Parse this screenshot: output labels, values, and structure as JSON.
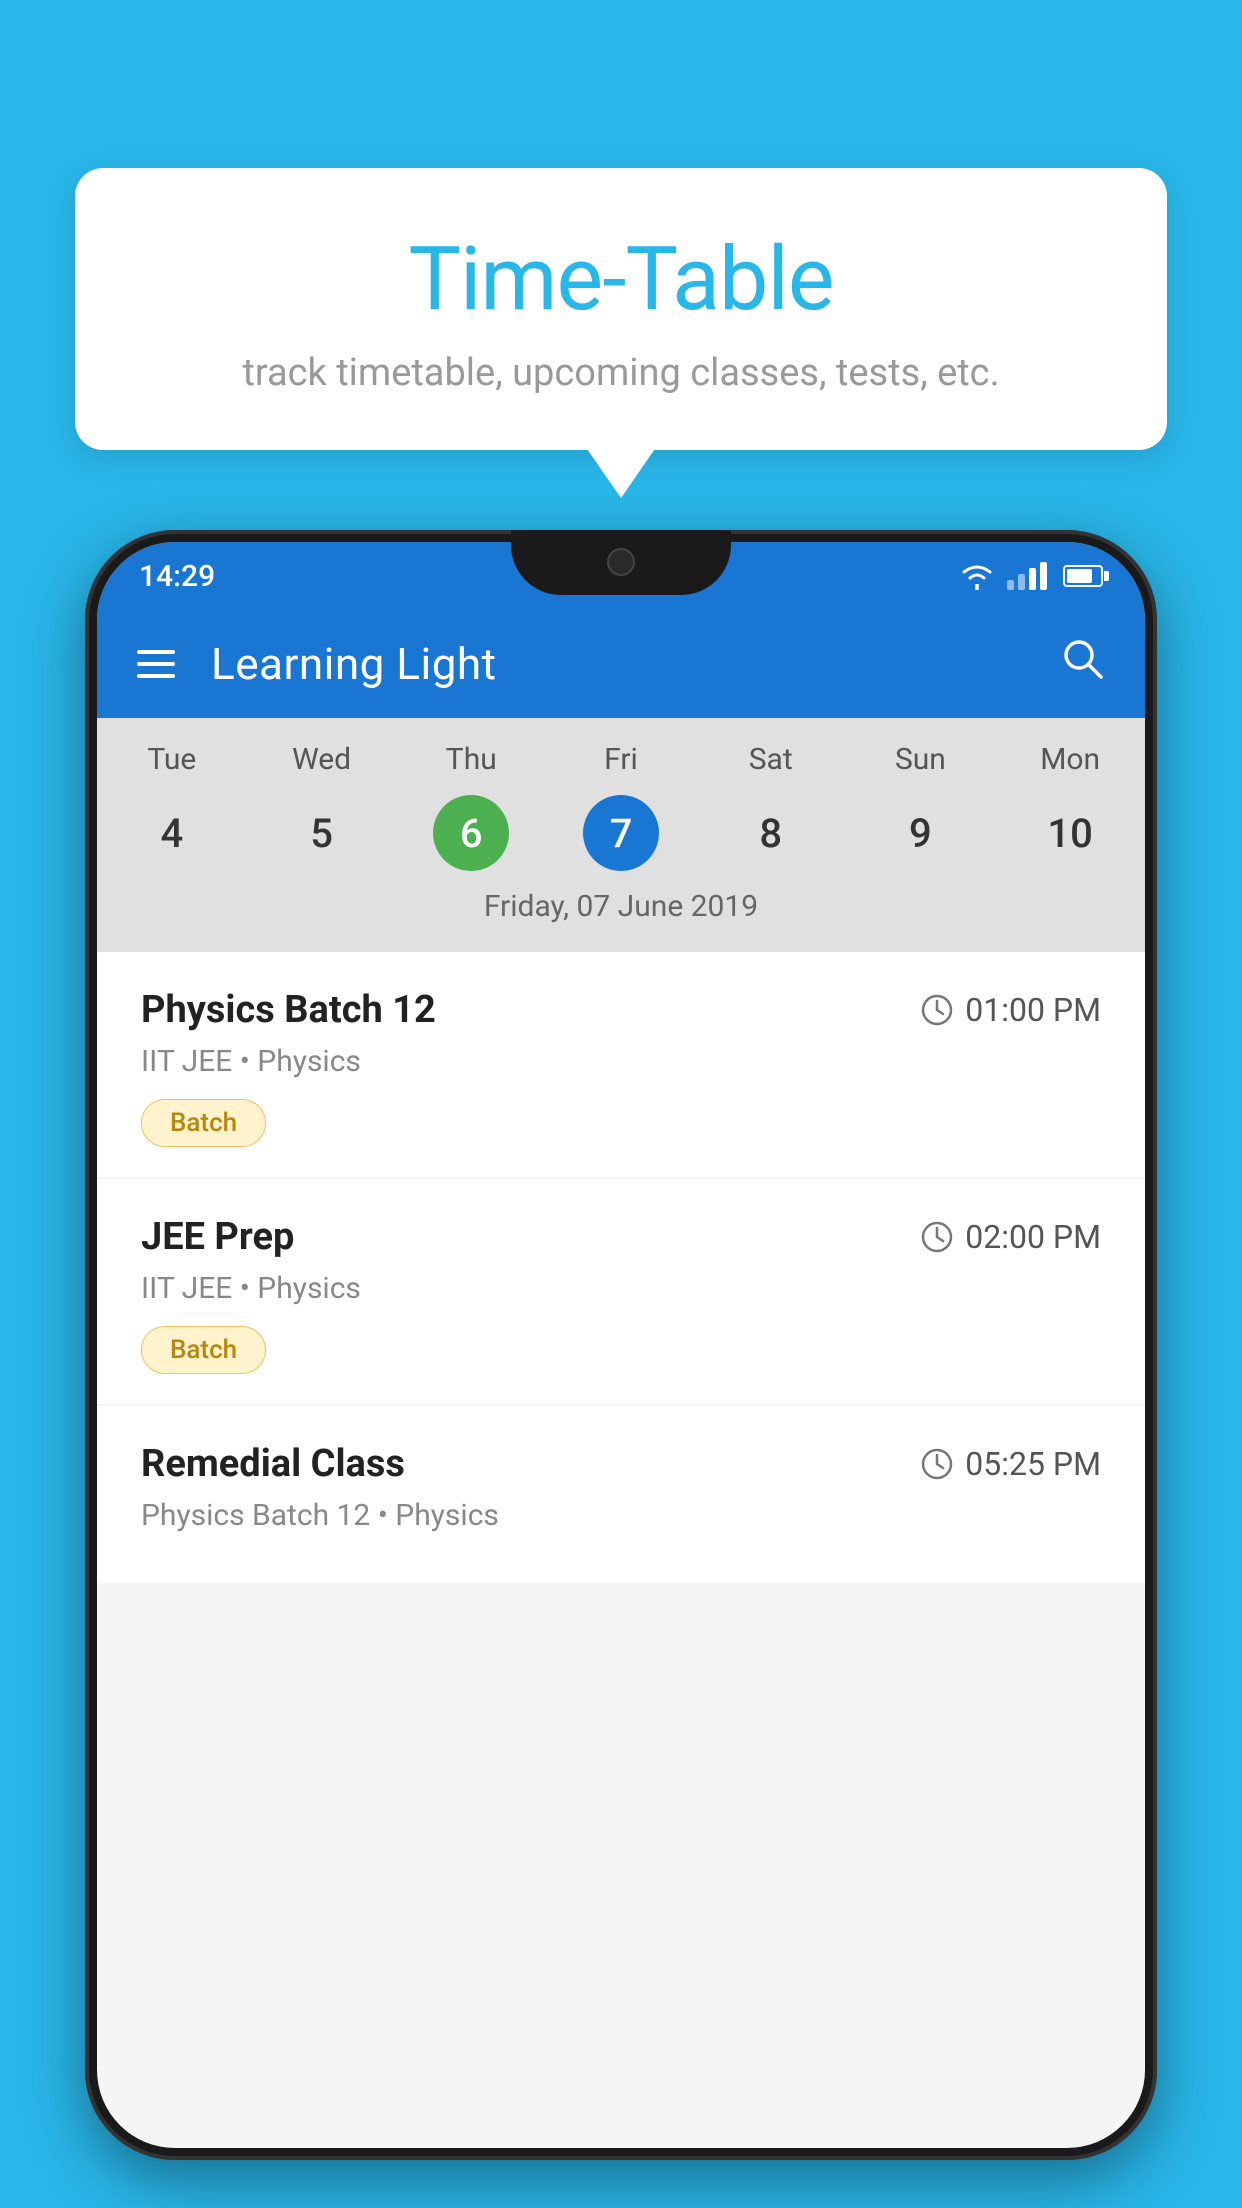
{
  "background_color": "#29b6e8",
  "tooltip": {
    "title": "Time-Table",
    "subtitle": "track timetable, upcoming classes, tests, etc."
  },
  "phone": {
    "status_bar": {
      "time": "14:29"
    },
    "app_bar": {
      "title": "Learning Light"
    },
    "calendar": {
      "days": [
        {
          "label": "Tue",
          "number": "4"
        },
        {
          "label": "Wed",
          "number": "5"
        },
        {
          "label": "Thu",
          "number": "6",
          "state": "today"
        },
        {
          "label": "Fri",
          "number": "7",
          "state": "selected"
        },
        {
          "label": "Sat",
          "number": "8"
        },
        {
          "label": "Sun",
          "number": "9"
        },
        {
          "label": "Mon",
          "number": "10"
        }
      ],
      "selected_date_label": "Friday, 07 June 2019"
    },
    "schedule": [
      {
        "title": "Physics Batch 12",
        "time": "01:00 PM",
        "meta": "IIT JEE • Physics",
        "badge": "Batch"
      },
      {
        "title": "JEE Prep",
        "time": "02:00 PM",
        "meta": "IIT JEE • Physics",
        "badge": "Batch"
      },
      {
        "title": "Remedial Class",
        "time": "05:25 PM",
        "meta": "Physics Batch 12 • Physics",
        "badge": null
      }
    ]
  }
}
